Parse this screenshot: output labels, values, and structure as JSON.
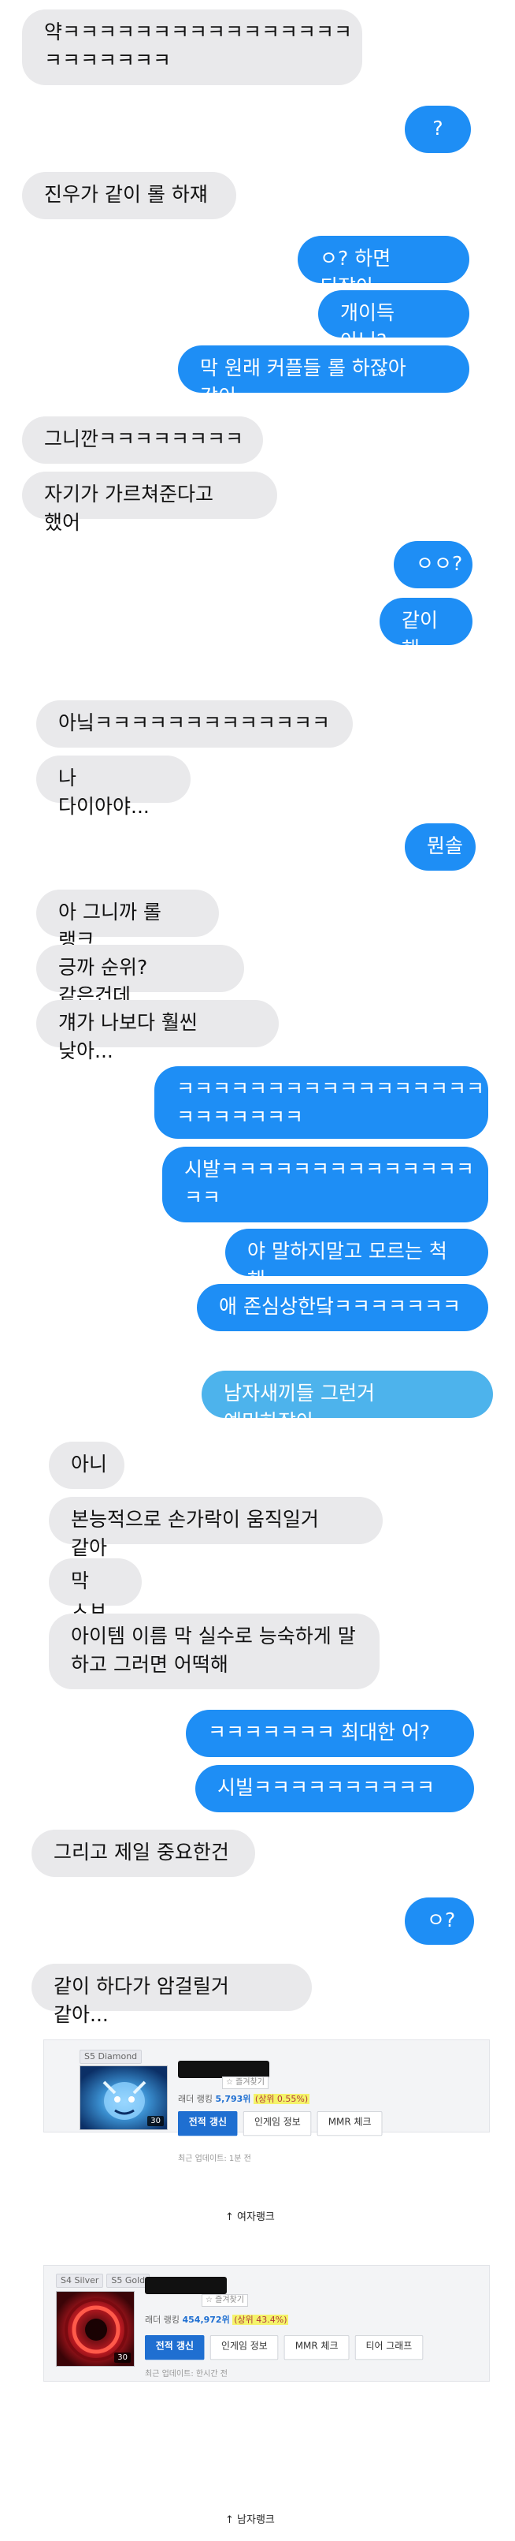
{
  "messages": [
    {
      "side": "recv",
      "text": "약ㅋㅋㅋㅋㅋㅋㅋㅋㅋㅋㅋㅋㅋㅋㅋㅋ\nㅋㅋㅋㅋㅋㅋㅋ"
    },
    {
      "side": "sent",
      "text": "?"
    },
    {
      "side": "recv",
      "text": "진우가 같이 롤 하쟤"
    },
    {
      "side": "sent",
      "text": "ㅇ? 하면 되잖아"
    },
    {
      "side": "sent",
      "text": "개이득 아님?"
    },
    {
      "side": "sent",
      "text": "막 원래 커플들 롤 하잖아 같이"
    },
    {
      "side": "recv",
      "text": "그니깐ㅋㅋㅋㅋㅋㅋㅋㅋ"
    },
    {
      "side": "recv",
      "text": "자기가 가르쳐준다고 했어"
    },
    {
      "side": "sent",
      "text": "ㅇㅇ?"
    },
    {
      "side": "sent",
      "text": "같이 해"
    },
    {
      "side": "recv",
      "text": "아닠ㅋㅋㅋㅋㅋㅋㅋㅋㅋㅋㅋㅋㅋ"
    },
    {
      "side": "recv",
      "text": "나 다이아야..."
    },
    {
      "side": "sent",
      "text": "뭔솔"
    },
    {
      "side": "recv",
      "text": "아 그니까 롤 랭크"
    },
    {
      "side": "recv",
      "text": "긍까 순위? 같은건데"
    },
    {
      "side": "recv",
      "text": "걔가 나보다 훨씬 낮아..."
    },
    {
      "side": "sent",
      "text": "ㅋㅋㅋㅋㅋㅋㅋㅋㅋㅋㅋㅋㅋㅋㅋㅋㅋ\nㅋㅋㅋㅋㅋㅋㅋ"
    },
    {
      "side": "sent",
      "text": "시발ㅋㅋㅋㅋㅋㅋㅋㅋㅋㅋㅋㅋㅋㅋ\nㅋㅋ"
    },
    {
      "side": "sent",
      "text": "야 말하지말고 모르는 척 해"
    },
    {
      "side": "sent",
      "text": "애 존심상한닼ㅋㅋㅋㅋㅋㅋㅋ"
    },
    {
      "side": "sent",
      "text": "남자새끼들 그런거 예민하잖아"
    },
    {
      "side": "recv",
      "text": "아니"
    },
    {
      "side": "recv",
      "text": "본능적으로 손가락이 움직일거 같아"
    },
    {
      "side": "recv",
      "text": "막 ㅅㅂ"
    },
    {
      "side": "recv",
      "text": "아이템 이름 막 실수로 능숙하게 말\n하고 그러면 어떡해"
    },
    {
      "side": "sent",
      "text": "ㅋㅋㅋㅋㅋㅋㅋ 최대한 어?"
    },
    {
      "side": "sent",
      "text": "시빌ㅋㅋㅋㅋㅋㅋㅋㅋㅋㅋ"
    },
    {
      "side": "recv",
      "text": "그리고 제일 중요한건"
    },
    {
      "side": "sent",
      "text": "ㅇ?"
    },
    {
      "side": "recv",
      "text": "같이 하다가 암걸릴거 같아..."
    }
  ],
  "card_female": {
    "tiers": [
      "S5 Diamond"
    ],
    "favorite": "☆ 즐겨찾기",
    "rank_label": "래더 랭킹",
    "rank_value": "5,793위",
    "rank_pct": "(상위 0.55%)",
    "buttons": [
      "전적 갱신",
      "인게임 정보",
      "MMR 체크"
    ],
    "updated": "최근 업데이트: 1분 전",
    "level": "30",
    "caption": "↑ 여자랭크"
  },
  "card_male": {
    "tiers": [
      "S4 Silver",
      "S5 Gold"
    ],
    "favorite": "☆ 즐겨찾기",
    "rank_label": "래더 랭킹",
    "rank_value": "454,972위",
    "rank_pct": "(상위 43.4%)",
    "buttons": [
      "전적 갱신",
      "인게임 정보",
      "MMR 체크",
      "티어 그래프"
    ],
    "updated": "최근 업데이트: 한시간 전",
    "level": "30",
    "caption": "↑ 남자랭크"
  },
  "colors": {
    "received_bubble": "#e9e9eb",
    "sent_bubble": "#1e8ef5",
    "sent_bubble_light": "#4db3ec",
    "primary_button": "#1f6fd1"
  }
}
